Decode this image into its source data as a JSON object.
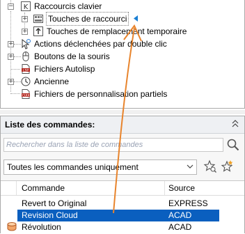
{
  "tree": {
    "items": [
      {
        "label": "Raccourcis clavier"
      },
      {
        "label": "Touches de raccourci"
      },
      {
        "label": "Touches de remplacement temporaire"
      },
      {
        "label": "Actions déclenchées par double clic"
      },
      {
        "label": "Boutons de la souris"
      },
      {
        "label": "Fichiers Autolisp"
      },
      {
        "label": "Ancienne"
      },
      {
        "label": "Fichiers de personnalisation partiels"
      }
    ]
  },
  "command_list": {
    "title": "Liste des commandes:",
    "search_placeholder": "Rechercher dans la liste de commandes",
    "filter_value": "Toutes les commandes uniquement",
    "columns": {
      "command": "Commande",
      "source": "Source"
    },
    "rows": [
      {
        "command": "Revert to Original",
        "source": "EXPRESS",
        "selected": false
      },
      {
        "command": "Revision Cloud",
        "source": "ACAD",
        "selected": true
      },
      {
        "command": "Révolution",
        "source": "ACAD",
        "selected": false
      }
    ]
  },
  "colors": {
    "selection": "#0a5fbf",
    "annotation_arrow": "#e8842c",
    "panel_header": "#eef0f3"
  },
  "icons": {
    "tree": [
      "keyboard-icon",
      "shortcut-keys-icon",
      "temp-override-icon",
      "double-click-icon",
      "mouse-icon",
      "lisp-file-icon",
      "legacy-icon",
      "partial-cui-icon"
    ],
    "panel": [
      "collapse-icon",
      "search-icon",
      "filter-star-icon",
      "new-command-star-icon",
      "dropdown-arrow-icon"
    ]
  }
}
